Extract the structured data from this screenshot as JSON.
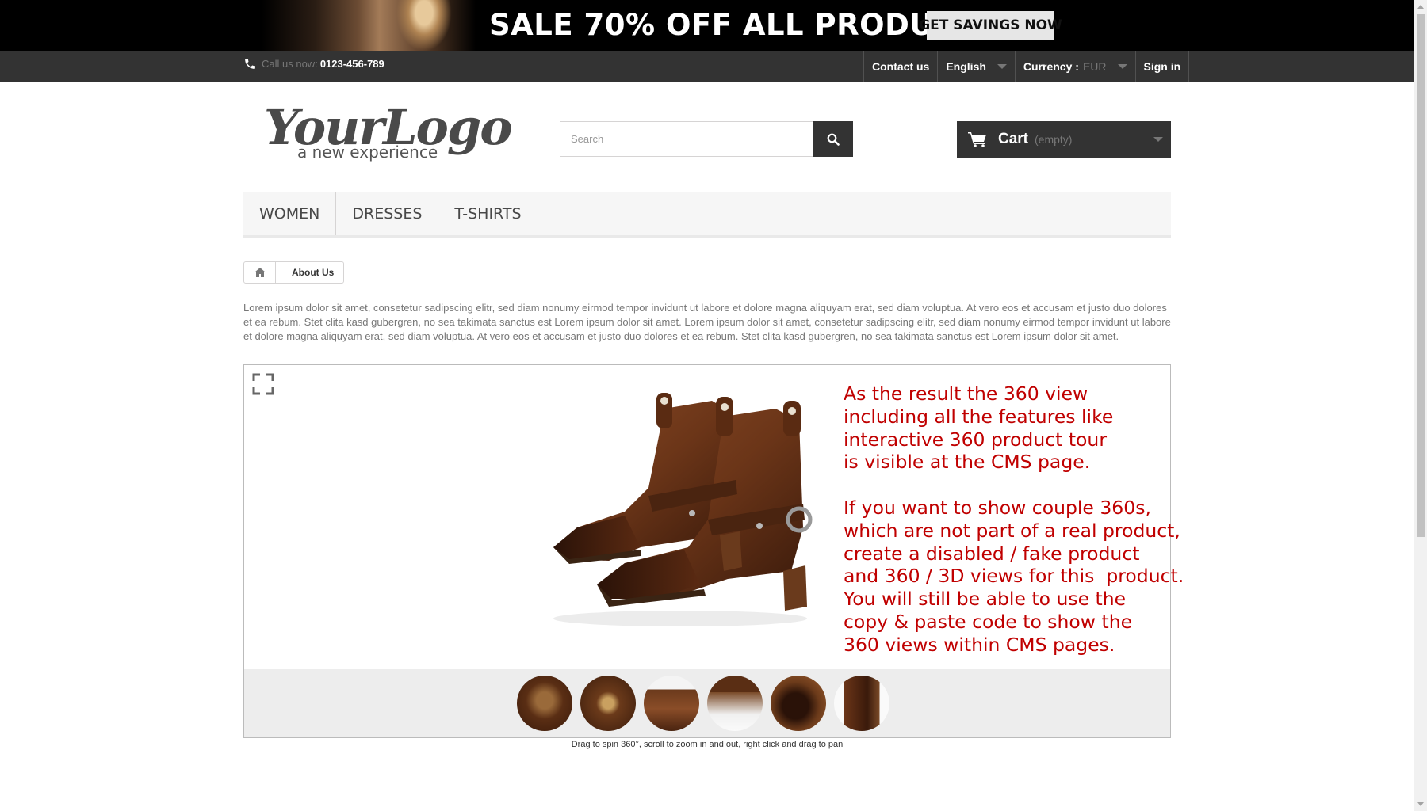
{
  "promo": {
    "headline": "SALE 70% OFF ALL PRODUCTS",
    "button_label": "GET SAVINGS NOW"
  },
  "navbar": {
    "call_label": "Call us now:",
    "call_number": "0123-456-789",
    "contact_label": "Contact us",
    "language_label": "English",
    "currency_label": "Currency :",
    "currency_value": "EUR",
    "signin_label": "Sign in"
  },
  "header": {
    "logo_text": "YourLogo",
    "logo_tagline": "a new experience",
    "search_placeholder": "Search",
    "cart_label": "Cart",
    "cart_status": "(empty)"
  },
  "menu": {
    "items": [
      "WOMEN",
      "DRESSES",
      "T-SHIRTS"
    ]
  },
  "breadcrumb": {
    "current": "About Us"
  },
  "content": {
    "paragraph": "Lorem ipsum dolor sit amet, consetetur sadipscing elitr, sed diam nonumy eirmod tempor invidunt ut labore et dolore magna aliquyam erat, sed diam voluptua. At vero eos et accusam et justo duo dolores et ea rebum. Stet clita kasd gubergren, no sea takimata sanctus est Lorem ipsum dolor sit amet. Lorem ipsum dolor sit amet, consetetur sadipscing elitr, sed diam nonumy eirmod tempor invidunt ut labore et dolore magna aliquyam erat, sed diam voluptua. At vero eos et accusam et justo duo dolores et ea rebum. Stet clita kasd gubergren, no sea takimata sanctus est Lorem ipsum dolor sit amet."
  },
  "viewer": {
    "note": "As the result the 360 view\nincluding all the features like\ninteractive 360 product tour\nis visible at the CMS page.\n\nIf you want to show couple 360s,\nwhich are not part of a real product,\ncreate a disabled / fake product\nand 360 / 3D views for this  product.\nYou will still be able to use the\ncopy & paste code to show the\n360 views within CMS pages.",
    "caption": "Drag to spin 360°, scroll to zoom in and out, right click and drag to pan",
    "thumbnails": [
      "thumb-1",
      "thumb-2",
      "thumb-3",
      "thumb-4",
      "thumb-5",
      "thumb-6"
    ]
  },
  "colors": {
    "accent_dark": "#333333",
    "note_red": "#c00000"
  }
}
